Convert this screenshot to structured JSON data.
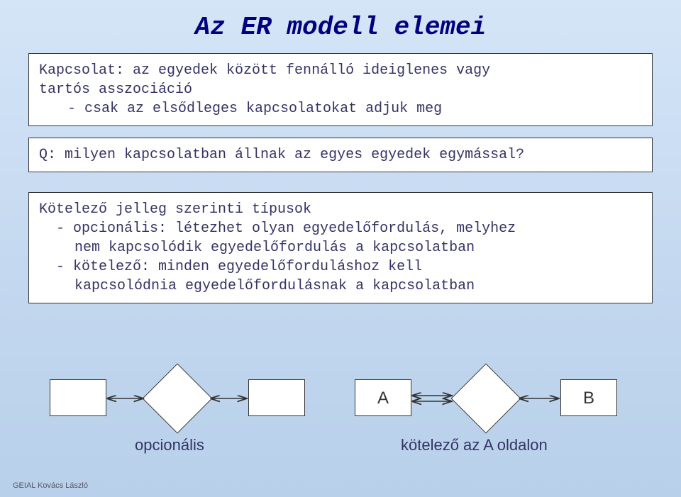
{
  "title": "Az ER modell elemei",
  "box1": {
    "line1": "Kapcsolat: az egyedek között fennálló ideiglenes vagy",
    "line2": "tartós asszociáció",
    "line3": "- csak az elsődleges kapcsolatokat adjuk meg"
  },
  "box2": {
    "line1": "Q: milyen kapcsolatban állnak az egyes egyedek egymással?"
  },
  "box3": {
    "line1": "Kötelező jelleg szerinti típusok",
    "line2": "- opcionális: létezhet olyan egyedelőfordulás, melyhez",
    "line3": "nem kapcsolódik egyedelőfordulás a kapcsolatban",
    "line4": "- kötelező: minden egyedelőforduláshoz kell",
    "line5": "kapcsolódnia egyedelőfordulásnak a kapcsolatban"
  },
  "diagram": {
    "left_caption": "opcionális",
    "right_caption": "kötelező az A oldalon",
    "labelA": "A",
    "labelB": "B"
  },
  "footer": "GEIAL Kovács László"
}
